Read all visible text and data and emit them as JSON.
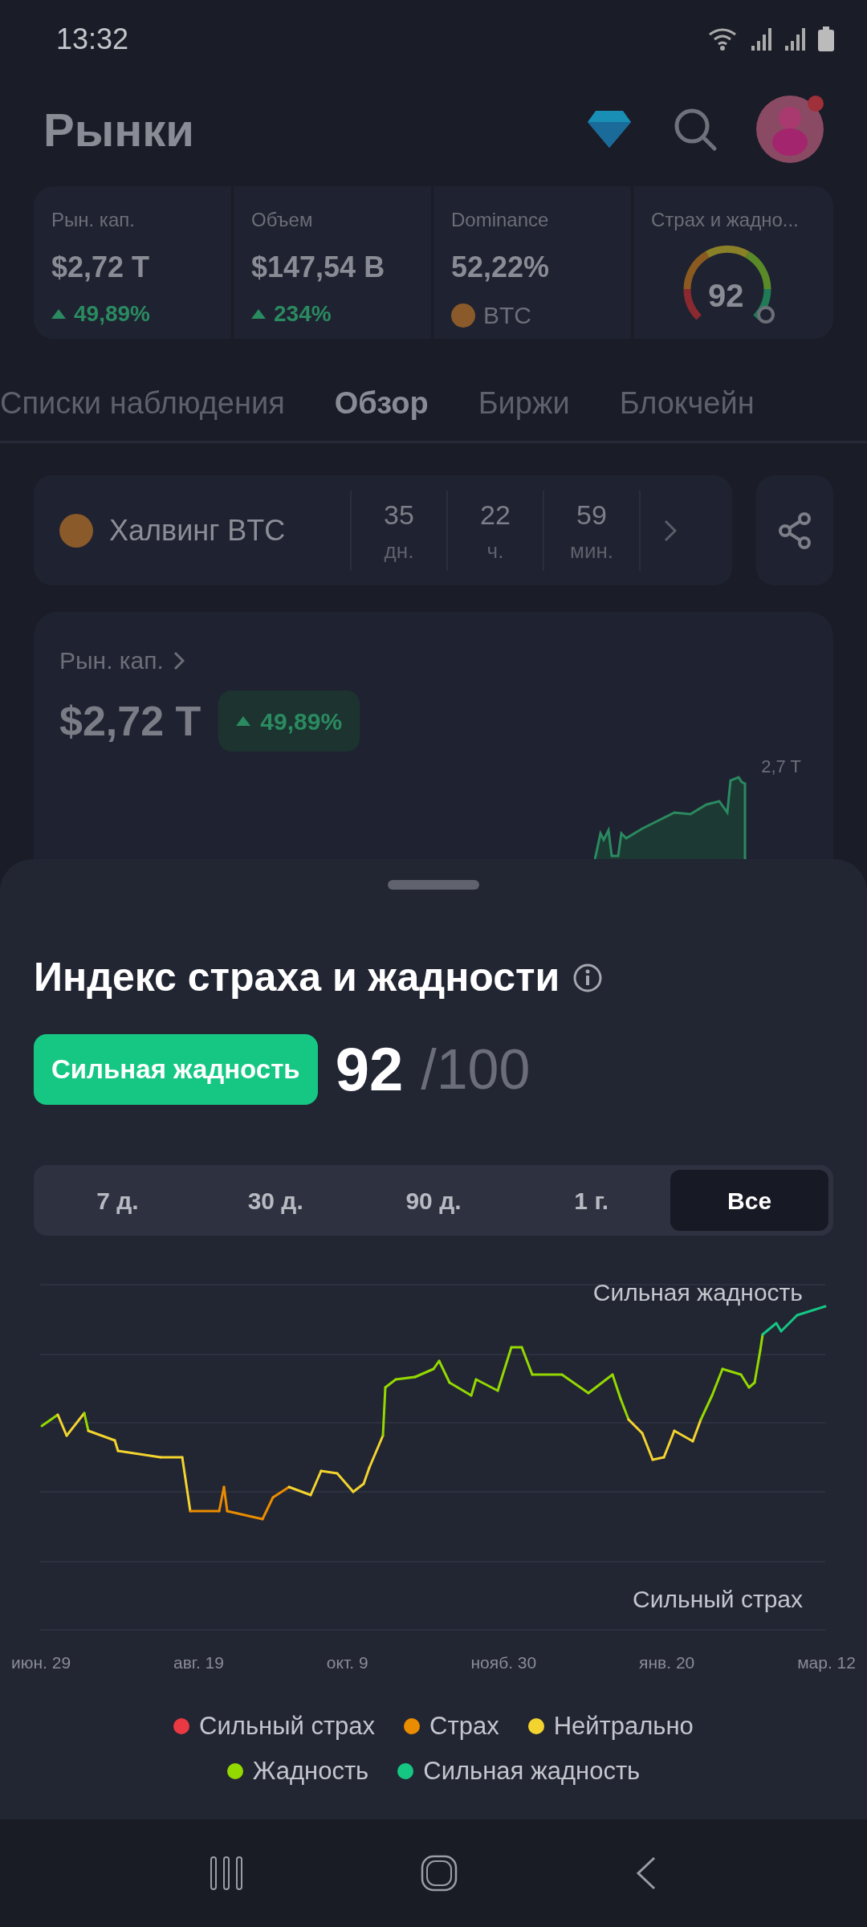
{
  "status_bar": {
    "time": "13:32"
  },
  "header": {
    "title": "Рынки"
  },
  "stats": [
    {
      "kind": "change",
      "label": "Рын. кап.",
      "value": "$2,72 T",
      "change": "49,89%"
    },
    {
      "kind": "change",
      "label": "Объем",
      "value": "$147,54 B",
      "change": "234%"
    },
    {
      "kind": "coin",
      "label": "Dominance",
      "value": "52,22%",
      "coin": "BTC"
    },
    {
      "kind": "gauge",
      "label": "Страх и жадно...",
      "value": "92"
    }
  ],
  "tabs": [
    {
      "label": "Списки наблюдения",
      "selected": false
    },
    {
      "label": "Обзор",
      "selected": true
    },
    {
      "label": "Биржи",
      "selected": false
    },
    {
      "label": "Блокчейн",
      "selected": false
    }
  ],
  "halving": {
    "label": "Халвинг BTC",
    "countdown": [
      {
        "value": "35",
        "unit": "дн."
      },
      {
        "value": "22",
        "unit": "ч."
      },
      {
        "value": "59",
        "unit": "мин."
      }
    ]
  },
  "market_cap_card": {
    "label": "Рын. кап.",
    "value": "$2,72 T",
    "change": "49,89%",
    "chart_label": "2,7 T"
  },
  "sheet": {
    "title": "Индекс страха и жадности",
    "rating": "Сильная жадность",
    "score": "92",
    "max": "/100",
    "periods": [
      {
        "label": "7 д.",
        "selected": false
      },
      {
        "label": "30 д.",
        "selected": false
      },
      {
        "label": "90 д.",
        "selected": false
      },
      {
        "label": "1 г.",
        "selected": false
      },
      {
        "label": "Все",
        "selected": true
      }
    ],
    "chart": {
      "top_label": "Сильная жадность",
      "bottom_label": "Сильный страх",
      "x_labels": [
        "июн. 29",
        "авг. 19",
        "окт. 9",
        "нояб. 30",
        "янв. 20",
        "мар. 12"
      ]
    },
    "legend": [
      {
        "label": "Сильный страх",
        "color": "#ea3943"
      },
      {
        "label": "Страх",
        "color": "#ea8c00"
      },
      {
        "label": "Нейтрально",
        "color": "#f3d42f"
      },
      {
        "label": "Жадность",
        "color": "#93d900"
      },
      {
        "label": "Сильная жадность",
        "color": "#16c784"
      }
    ]
  }
}
